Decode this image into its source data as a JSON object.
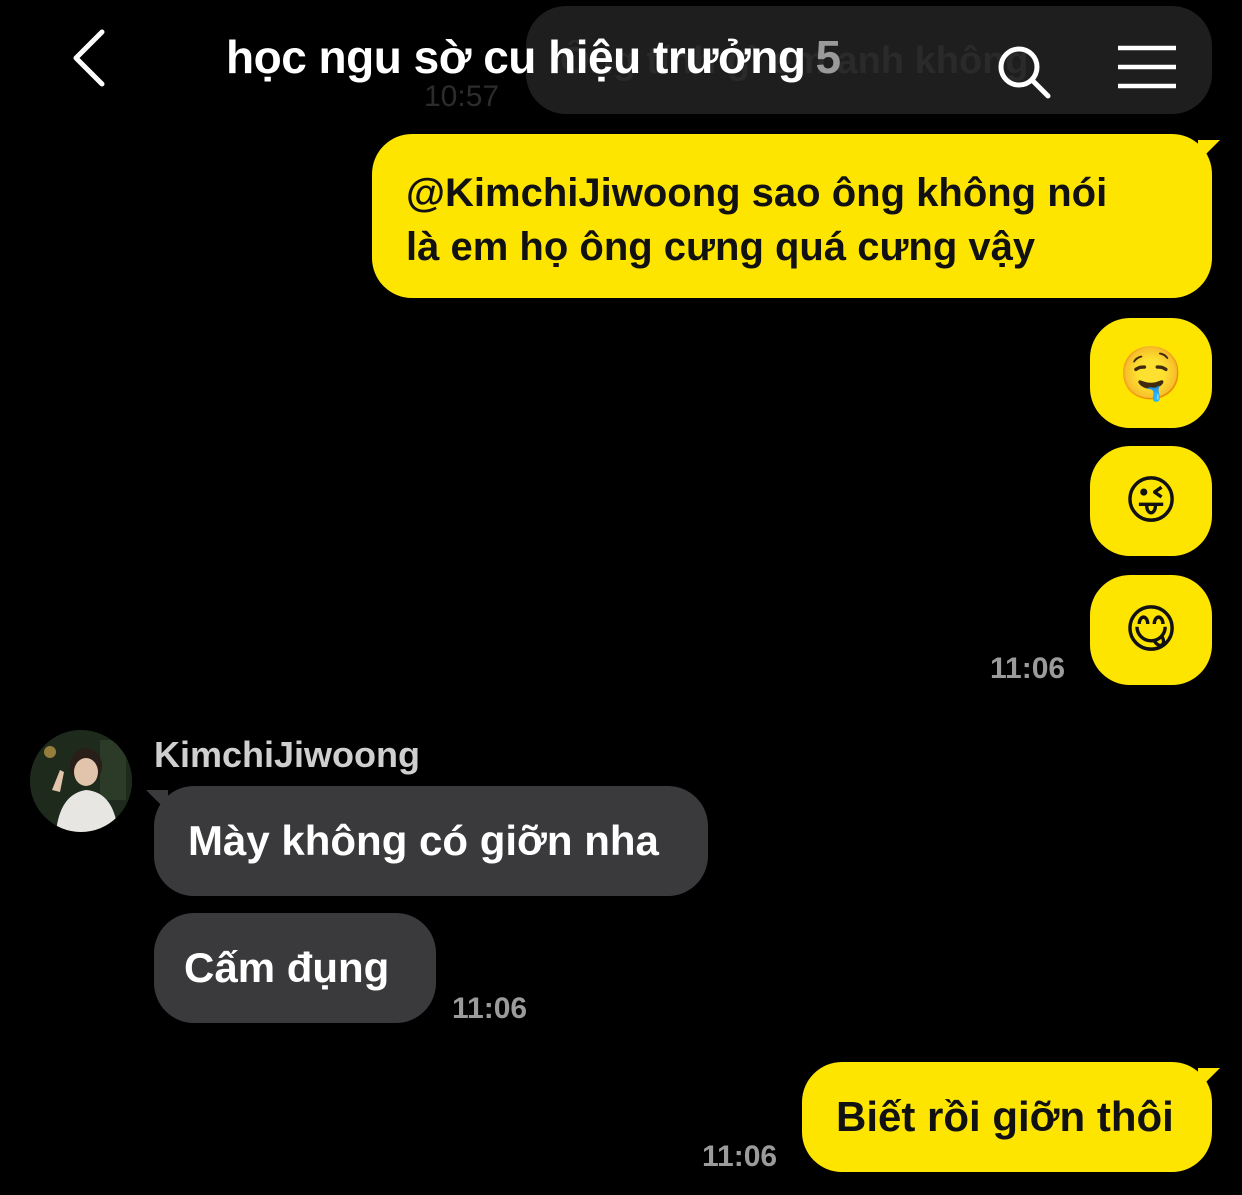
{
  "previous": {
    "text": "Ông tính gì em anh không",
    "time": "10:57"
  },
  "header": {
    "title": "học ngu sờ cu hiệu trưởng",
    "member_count": "5",
    "icons": [
      "chevron-left-icon",
      "search-icon",
      "menu-icon"
    ]
  },
  "messages": {
    "out1": {
      "line1": "@KimchiJiwoong sao ông không nói",
      "line2": "là em họ ông cưng quá cưng vậy"
    },
    "out_emoji": [
      "🤤",
      "😜",
      "😋"
    ],
    "out_time": "11:06",
    "sender": "KimchiJiwoong",
    "in1": "Mày không có giỡn nha",
    "in2": "Cấm đụng",
    "in_time": "11:06",
    "out_last": "Biết rồi giỡn thôi",
    "out_last_time": "11:06"
  },
  "colors": {
    "background": "#000000",
    "outgoing_bubble": "#fee500",
    "incoming_bubble": "#3a3a3c",
    "timestamp": "#9b9b9b"
  }
}
